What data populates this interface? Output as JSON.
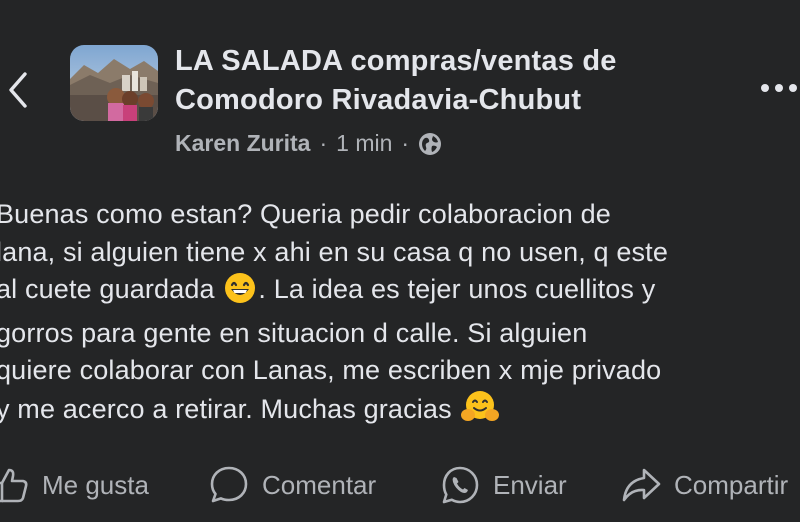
{
  "header": {
    "group_name": "LA SALADA compras/ventas de\nComodoro Rivadavia-Chubut",
    "author": "Karen Zurita",
    "separator": "·",
    "time": "1 min",
    "privacy_icon": "globe-icon"
  },
  "post": {
    "lines": [
      "Buenas como estan? Queria pedir colaboracion de",
      "lana, si alguien tiene x ahi en su casa q no usen, q este",
      "al cuete guardada",
      ". La idea es tejer unos cuellitos y",
      "gorros para gente en situacion d calle. Si alguien",
      "quiere colaborar con Lanas, me escriben x mje privado",
      "y me acerco a retirar. Muchas gracias"
    ],
    "emojis": [
      "grinning-face-emoji",
      "hugging-face-emoji"
    ]
  },
  "actions": {
    "like": "Me gusta",
    "comment": "Comentar",
    "send": "Enviar",
    "share": "Compartir"
  }
}
